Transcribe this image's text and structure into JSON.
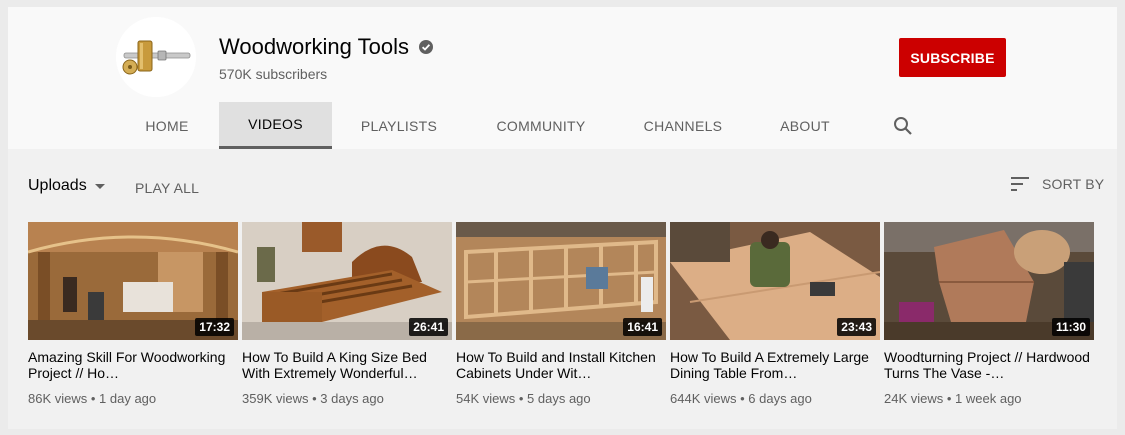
{
  "channel": {
    "name": "Woodworking Tools",
    "subscribers": "570K subscribers",
    "subscribe_label": "SUBSCRIBE",
    "verified_icon": "check-circle-icon"
  },
  "tabs": [
    {
      "label": "HOME",
      "active": false
    },
    {
      "label": "VIDEOS",
      "active": true
    },
    {
      "label": "PLAYLISTS",
      "active": false
    },
    {
      "label": "COMMUNITY",
      "active": false
    },
    {
      "label": "CHANNELS",
      "active": false
    },
    {
      "label": "ABOUT",
      "active": false
    }
  ],
  "toolbar": {
    "uploads_label": "Uploads",
    "play_all_label": "PLAY ALL",
    "sort_by_label": "SORT BY"
  },
  "videos": [
    {
      "title": "Amazing Skill For Woodworking Project // Ho…",
      "duration": "17:32",
      "views": "86K views",
      "age": "1 day ago"
    },
    {
      "title": "How To Build A King Size Bed With Extremely Wonderful…",
      "duration": "26:41",
      "views": "359K views",
      "age": "3 days ago"
    },
    {
      "title": "How To Build and Install Kitchen Cabinets Under Wit…",
      "duration": "16:41",
      "views": "54K views",
      "age": "5 days ago"
    },
    {
      "title": "How To Build A Extremely Large Dining Table From…",
      "duration": "23:43",
      "views": "644K views",
      "age": "6 days ago"
    },
    {
      "title": "Woodturning Project // Hardwood Turns The Vase -…",
      "duration": "11:30",
      "views": "24K views",
      "age": "1 week ago"
    }
  ],
  "colors": {
    "subscribe_bg": "#cc0000",
    "active_tab_bg": "#e0e0e0",
    "meta_text": "#606060"
  }
}
